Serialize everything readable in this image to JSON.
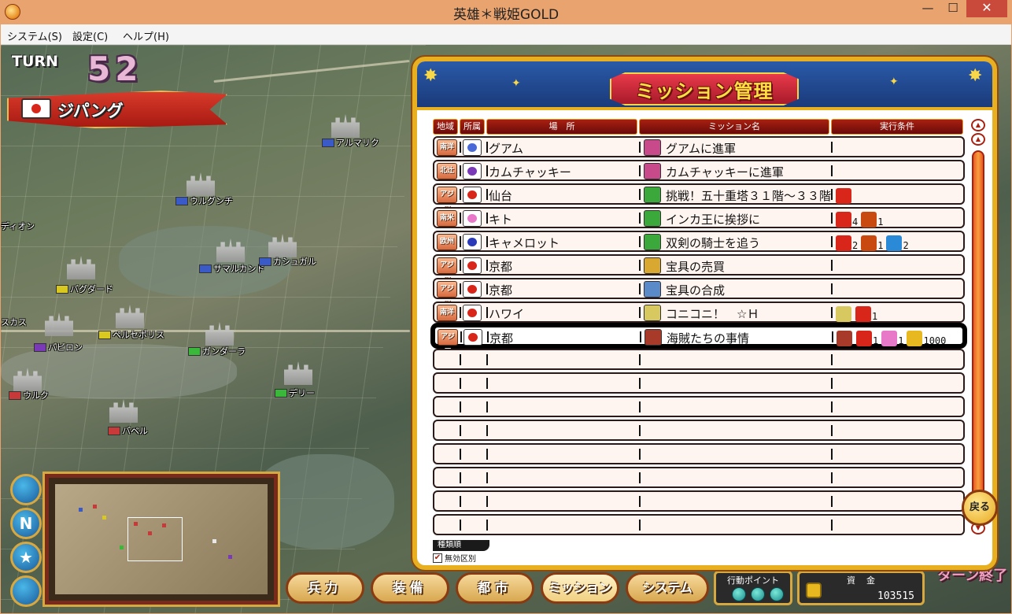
{
  "window": {
    "title": "英雄＊戦姫GOLD",
    "minimize": "—",
    "maximize": "☐",
    "close": "✕"
  },
  "menu": [
    "システム(S)",
    "設定(C)",
    "ヘルプ(H)"
  ],
  "hud": {
    "turn_label": "TURN",
    "turn_number": "52",
    "country": "ジパング"
  },
  "map_cities": [
    {
      "name": "アルマリク",
      "flag_color": "#3a5ac8"
    },
    {
      "name": "ウルグンチ",
      "flag_color": "#3a5ac8"
    },
    {
      "name": "ディオン",
      "flag_color": ""
    },
    {
      "name": "サマルカンド",
      "flag_color": "#3a5ac8"
    },
    {
      "name": "カシュガル",
      "flag_color": "#3a5ac8"
    },
    {
      "name": "バグダード",
      "flag_color": "#d8c820"
    },
    {
      "name": "スカス",
      "flag_color": ""
    },
    {
      "name": "ペルセポリス",
      "flag_color": "#d8c820"
    },
    {
      "name": "バビロン",
      "flag_color": "#7a3ab8"
    },
    {
      "name": "ガンダーラ",
      "flag_color": "#3ab83a"
    },
    {
      "name": "デリー",
      "flag_color": "#3ab83a"
    },
    {
      "name": "ウルク",
      "flag_color": "#c83a3a"
    },
    {
      "name": "バベル",
      "flag_color": "#c83a3a"
    }
  ],
  "mission_panel": {
    "title": "ミッション管理",
    "headers": {
      "region": "地域",
      "affiliation": "所属",
      "place": "場　所",
      "mission": "ミッション名",
      "condition": "実行条件"
    },
    "rows": [
      {
        "region": "南洋",
        "affil_color": "#4a6ad8",
        "place": "グアム",
        "mission": "グアムに進軍",
        "icon_color": "#c84a8a",
        "conditions": []
      },
      {
        "region": "北辻",
        "affil_color": "#7a3ab8",
        "place": "カムチャッキー",
        "mission": "カムチャッキーに進軍",
        "icon_color": "#c84a8a",
        "conditions": []
      },
      {
        "region": "アジア",
        "affil_color": "#d8261a",
        "place": "仙台",
        "mission": "挑戦！五十重塔３１階～３３階",
        "icon_color": "#3aa83a",
        "conditions": [
          {
            "color": "#d8261a",
            "count": ""
          }
        ]
      },
      {
        "region": "南米",
        "affil_color": "#e878c8",
        "place": "キト",
        "mission": "インカ王に挨拶に",
        "icon_color": "#3aa83a",
        "conditions": [
          {
            "color": "#d8261a",
            "count": "4"
          },
          {
            "color": "#c84a10",
            "count": "1"
          }
        ]
      },
      {
        "region": "欧州",
        "affil_color": "#2a3ab8",
        "place": "キャメロット",
        "mission": "双剣の騎士を追う",
        "icon_color": "#3aa83a",
        "conditions": [
          {
            "color": "#d8261a",
            "count": "2"
          },
          {
            "color": "#c84a10",
            "count": "1"
          },
          {
            "color": "#2a8ad8",
            "count": "2"
          }
        ]
      },
      {
        "region": "アジア",
        "affil_color": "#d8261a",
        "place": "京都",
        "mission": "宝具の売買",
        "icon_color": "#d8a830",
        "conditions": []
      },
      {
        "region": "アジア",
        "affil_color": "#d8261a",
        "place": "京都",
        "mission": "宝具の合成",
        "icon_color": "#5a8ac8",
        "conditions": []
      },
      {
        "region": "南洋",
        "affil_color": "#d8261a",
        "place": "ハワイ",
        "mission": "コニコニ！　☆Ｈ",
        "icon_color": "#d8c860",
        "conditions": [
          {
            "color": "#d8c860",
            "count": ""
          },
          {
            "color": "#d8261a",
            "count": "1"
          }
        ]
      },
      {
        "region": "アジア",
        "affil_color": "#d8261a",
        "place": "京都",
        "mission": "海賊たちの事情",
        "icon_color": "#a83a2a",
        "conditions": [
          {
            "color": "#a83a2a",
            "count": ""
          },
          {
            "color": "#d8261a",
            "count": "1"
          },
          {
            "color": "#e878c8",
            "count": "1"
          },
          {
            "color": "#e8b820",
            "count": "1000"
          }
        ],
        "selected": true
      }
    ],
    "empty_rows": 8,
    "sort_label": "種類順",
    "checkbox_label": "無効区別",
    "checkbox_checked": true,
    "back_label": "戻る"
  },
  "side_buttons": [
    "",
    "N",
    "★",
    ""
  ],
  "bottom_buttons": [
    {
      "label": "兵力",
      "active": false
    },
    {
      "label": "装備",
      "active": false
    },
    {
      "label": "都市",
      "active": false
    },
    {
      "label": "ミッション",
      "active": true
    },
    {
      "label": "システム",
      "active": false
    }
  ],
  "action_points": {
    "label": "行動ポイント",
    "count": 3
  },
  "money": {
    "label": "資金",
    "value": "103515"
  },
  "turn_end_label": "ターン終了"
}
